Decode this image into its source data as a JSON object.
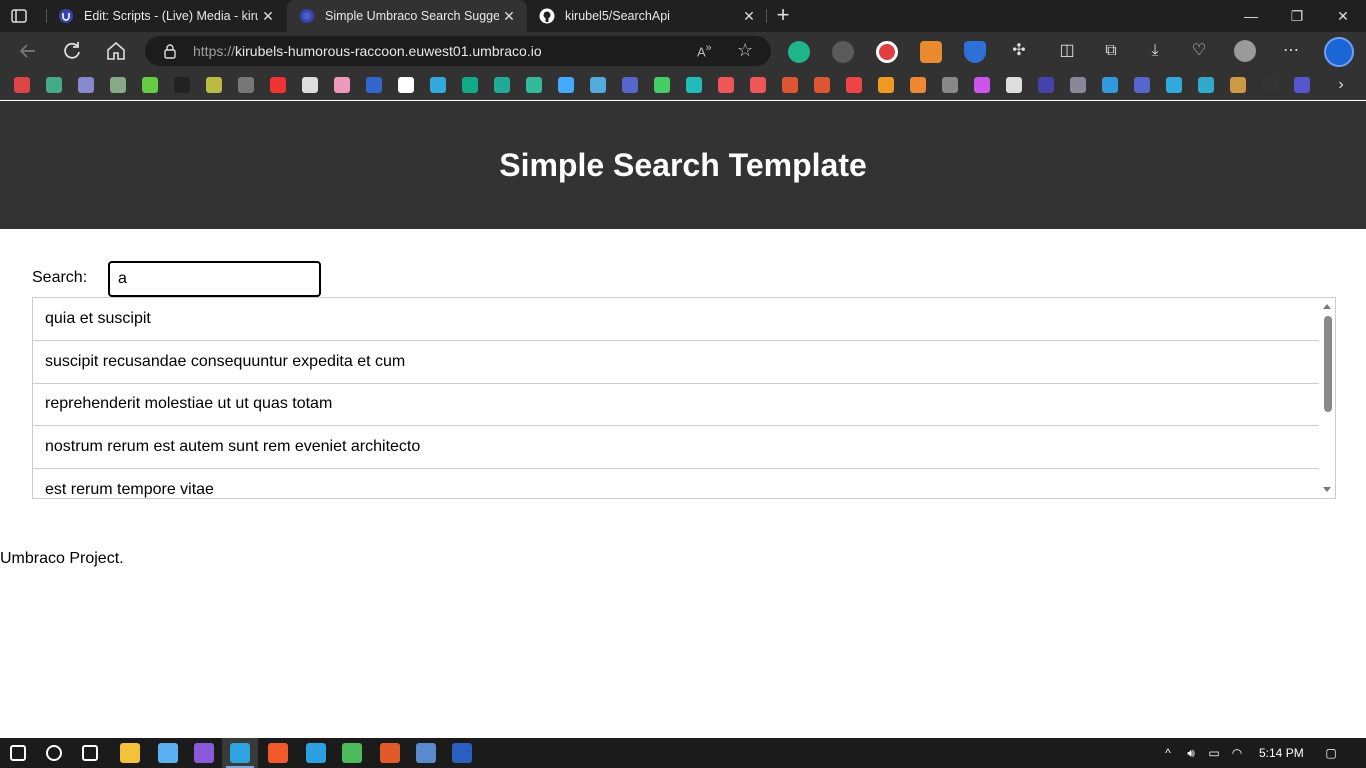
{
  "browser": {
    "tabs": [
      {
        "title": "Edit: Scripts - (Live) Media - kirub",
        "favicon": "umbraco-icon",
        "close": "✕"
      },
      {
        "title": "Simple Umbraco Search Suggest",
        "favicon": "umbraco-icon",
        "close": "✕"
      },
      {
        "title": "kirubel5/SearchApi",
        "favicon": "github-icon",
        "close": "✕"
      }
    ],
    "new_tab": "+",
    "window_controls": {
      "minimize": "—",
      "maximize": "❐",
      "close": "✕"
    },
    "address": {
      "protocol": "https://",
      "host": "kirubels-humorous-raccoon.euwest01.umbraco.io"
    },
    "bookmark_icons": [
      "gmail-icon",
      "gmail-icon",
      "gmail-icon",
      "chatgpt-icon",
      "upwork-icon",
      "fiverr-icon",
      "bookmark-icon",
      "bookmark-icon",
      "youtube-icon",
      "github-icon",
      "binance-icon",
      "bookmark-icon",
      "bookmark-icon",
      "bookmark-icon",
      "grammarly-icon",
      "bookmark-icon",
      "bookmark-icon",
      "azure-icon",
      "react-icon",
      "flag-icon",
      "maps-icon",
      "bookmark-icon",
      "svg-png-icon",
      "jpg-pdf-icon",
      "tool-icon",
      "tool-icon",
      "bookmark-icon",
      "microsoft-icon",
      "stackoverflow-icon",
      "bookmark-icon",
      "figma-icon",
      "bookmark-icon",
      "bookmark-icon",
      "bookmark-icon",
      "bookmark-icon",
      "bookmark-icon",
      "bookmark-icon",
      "bookmark-icon",
      "bookmark-icon",
      "sq-icon",
      "mail-icon"
    ]
  },
  "page": {
    "title": "Simple Search Template",
    "search": {
      "label": "Search:",
      "value": "a"
    },
    "suggestions": [
      "quia et suscipit",
      "suscipit recusandae consequuntur expedita et cum",
      "reprehenderit molestiae ut ut quas totam",
      "nostrum rerum est autem sunt rem eveniet architecto",
      "est rerum tempore vitae"
    ],
    "footer": "Umbraco Project."
  },
  "taskbar": {
    "apps": [
      "start-icon",
      "search-icon",
      "task-view-icon",
      "file-explorer-icon",
      "notepad-icon",
      "visual-studio-icon",
      "edge-icon",
      "brave-icon",
      "telegram-icon",
      "app-icon",
      "powerpoint-icon",
      "app-icon",
      "word-icon"
    ],
    "clock": "5:14 PM"
  },
  "colors": {
    "header_bg": "#333333",
    "chrome_dark": "#202020",
    "chrome_toolbar": "#323232"
  }
}
